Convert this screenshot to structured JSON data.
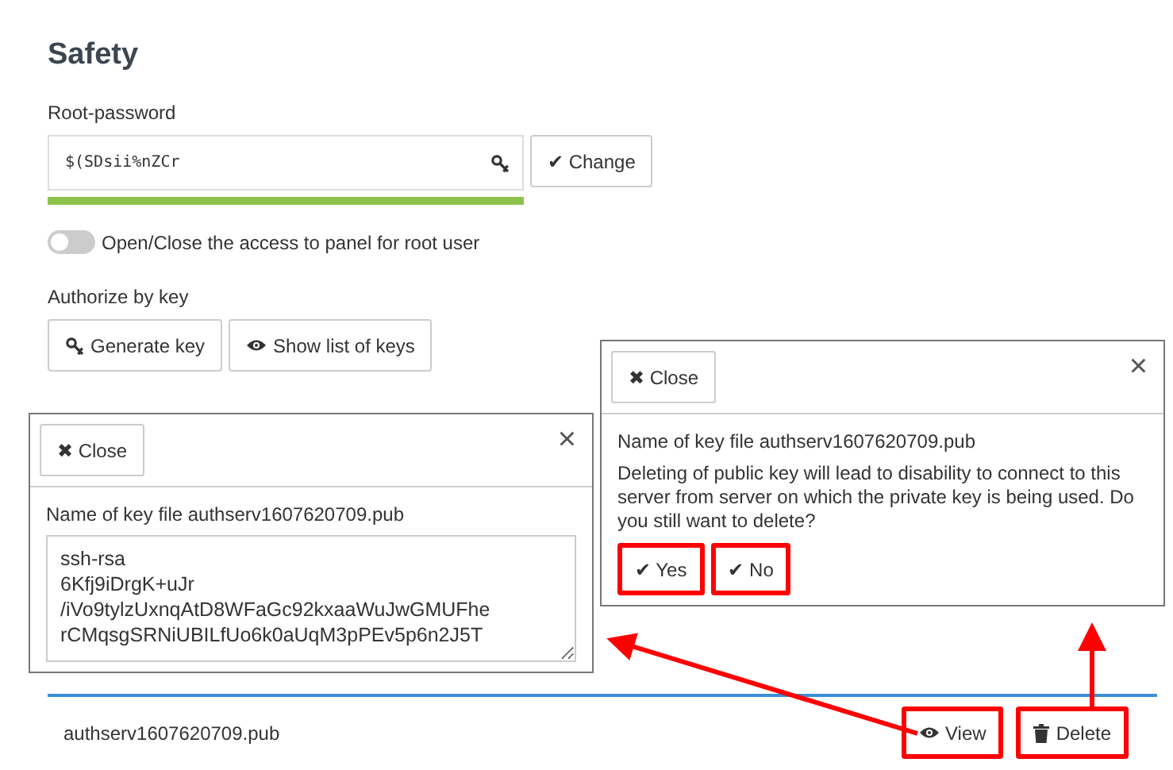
{
  "page_title": "Safety",
  "root_password": {
    "label": "Root-password",
    "value": "$(SDsii%nZCr",
    "strength": {
      "level": 1
    },
    "change_button": "✔ Change"
  },
  "root_access_toggle": {
    "on": false,
    "label": "Open/Close the access to panel for root user"
  },
  "authorize": {
    "label": "Authorize by key",
    "buttons": [
      {
        "kind": "key",
        "label": "Generate key"
      },
      {
        "kind": "eye",
        "label": "Show list of keys"
      }
    ]
  },
  "keys_table": {
    "rows": [
      {
        "name": "authserv1607620709.pub",
        "actions": [
          {
            "kind": "eye",
            "label": "View",
            "highlighted": true
          },
          {
            "kind": "trash",
            "label": "Delete",
            "highlighted": true
          }
        ]
      }
    ]
  },
  "view_dialog": {
    "close_button": "✖ Close",
    "close_glyph": "×",
    "file_label": "Name of key file authserv1607620709.pub",
    "key_text": "ssh-rsa\n6Kfj9iDrgK+uJr\n/iVo9tylzUxnqAtD8WFaGc92kxaaWuJwGMUFhe\nrCMqsgSRNiUBILfUo6k0aUqM3pPEv5p6n2J5T"
  },
  "delete_dialog": {
    "close_button": "✖ Close",
    "close_glyph": "×",
    "file_label": "Name of key file authserv1607620709.pub",
    "message": "Deleting of public key will lead to disability to connect to this server from server on which the private key is being used. Do you still want to delete?",
    "buttons": [
      {
        "label": "✔ Yes",
        "highlighted": true
      },
      {
        "label": "✔ No",
        "highlighted": true
      }
    ]
  }
}
